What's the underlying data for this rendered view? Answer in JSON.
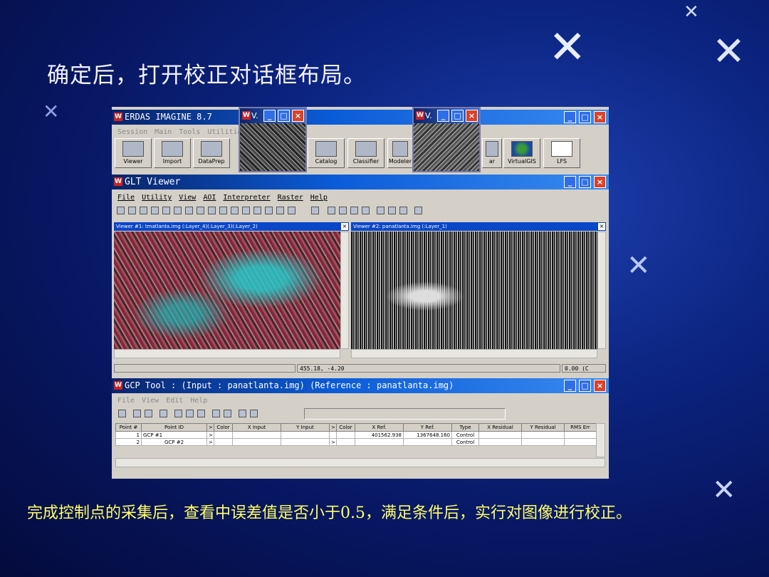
{
  "slide": {
    "title": "确定后，打开校正对话框布局。",
    "caption": "完成控制点的采集后，查看中误差值是否小于0.5，满足条件后，实行对图像进行校正。"
  },
  "erdas": {
    "title": "ERDAS IMAGINE 8.7",
    "menu": [
      "Session",
      "Main",
      "Tools",
      "Utilities"
    ],
    "buttons": [
      "Viewer",
      "Import",
      "DataPrep",
      "Catalog",
      "Classifier",
      "Modeler",
      "ar",
      "VirtualGIS",
      "LFS"
    ],
    "small_window_title": "V."
  },
  "glt": {
    "title": "GLT Viewer",
    "menu": [
      "File",
      "Utility",
      "View",
      "AOI",
      "Interpreter",
      "Raster",
      "Help"
    ],
    "viewer1_title": "Viewer #1: tmatlanta.img (:Layer_4)(:Layer_3)(:Layer_2)",
    "viewer2_title": "Viewer #2: panatlanta.img (:Layer_1)",
    "coord": "455.18, -4.20",
    "zoom": "0.00 (C"
  },
  "gcp": {
    "title": "GCP Tool : (Input : panatlanta.img) (Reference : panatlanta.img)",
    "menu": [
      "File",
      "View",
      "Edit",
      "Help"
    ],
    "columns": [
      "Point #",
      "Point ID",
      ">",
      "Color",
      "X Input",
      "Y Input",
      ">",
      "Color",
      "X Ref.",
      "Y Ref.",
      "Type",
      "X Residual",
      "Y Residual",
      "RMS Err"
    ],
    "rows": [
      {
        "num": "1",
        "id": "GCP #1",
        "mark1": ">",
        "xref": "401562.938",
        "yref": "1367648.160",
        "type": "Control"
      },
      {
        "num": "2",
        "id": "GCP #2",
        "mark1": ">",
        "mark2": ">",
        "xref": "",
        "yref": "",
        "type": "Control"
      }
    ]
  }
}
